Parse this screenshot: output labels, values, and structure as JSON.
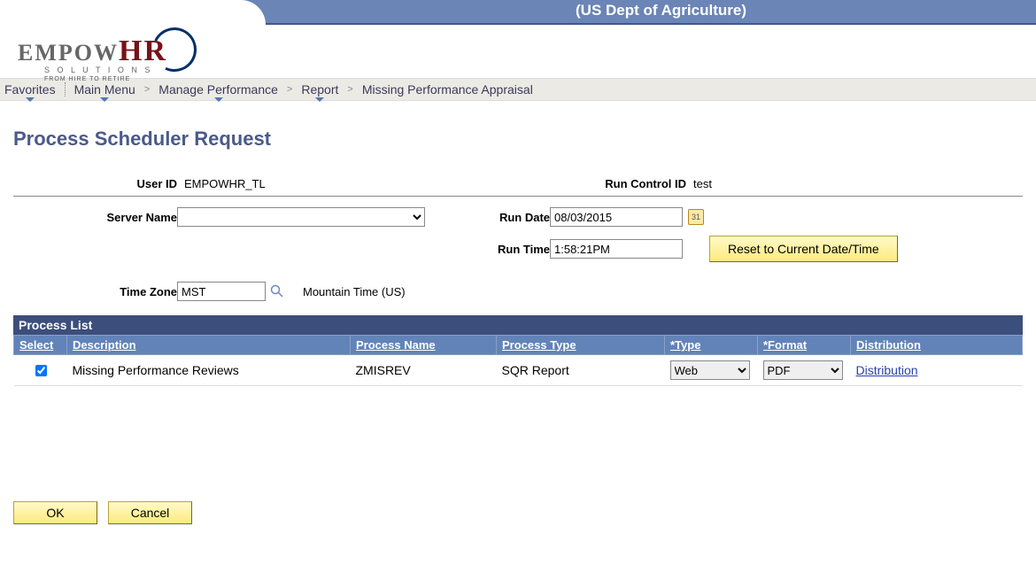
{
  "header": {
    "org_title": "(US Dept of Agriculture)",
    "logo_main_1": "EMPOW",
    "logo_main_2": "HR",
    "logo_sub1": "S O L U T I O N S",
    "logo_sub2": "FROM HIRE TO RETIRE"
  },
  "breadcrumb": {
    "favorites": "Favorites",
    "main_menu": "Main Menu",
    "item1": "Manage Performance",
    "item2": "Report",
    "item3": "Missing Performance Appraisal"
  },
  "page": {
    "title": "Process Scheduler Request",
    "user_id_label": "User ID",
    "user_id_value": "EMPOWHR_TL",
    "run_control_label": "Run Control ID",
    "run_control_value": "test",
    "server_name_label": "Server Name",
    "run_date_label": "Run Date",
    "run_date_value": "08/03/2015",
    "run_time_label": "Run Time",
    "run_time_value": "1:58:21PM",
    "reset_button": "Reset to Current Date/Time",
    "tz_label": "Time Zone",
    "tz_value": "MST",
    "tz_desc": "Mountain Time (US)"
  },
  "process_list": {
    "title": "Process List",
    "headers": {
      "select": "Select",
      "description": "Description",
      "process_name": "Process Name",
      "process_type": "Process Type",
      "type": "*Type",
      "format": "*Format",
      "distribution": "Distribution"
    },
    "row": {
      "selected": true,
      "description": "Missing Performance Reviews",
      "process_name": "ZMISREV",
      "process_type": "SQR Report",
      "type": "Web",
      "format": "PDF",
      "distribution": "Distribution"
    }
  },
  "actions": {
    "ok": "OK",
    "cancel": "Cancel"
  }
}
